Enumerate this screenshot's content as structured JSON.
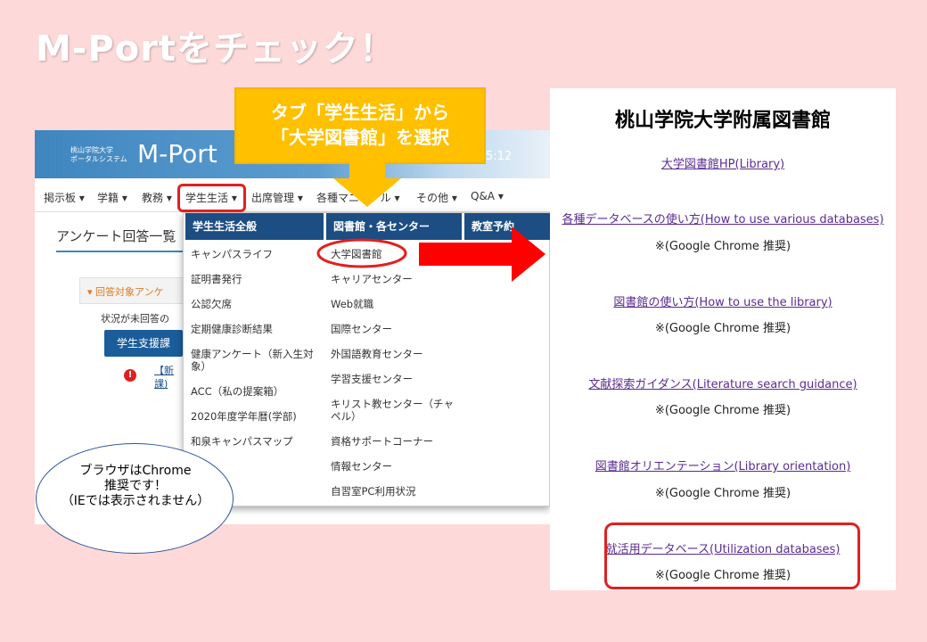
{
  "slide": {
    "title": "M-Portをチェック！"
  },
  "portal": {
    "logo_small_line1": "桃山学院大学",
    "logo_small_line2": "ポータルシステム",
    "logo_big": "M-Port",
    "clock": "5:12",
    "menu": [
      "掲示板 ▾",
      "学籍 ▾",
      "教務 ▾",
      "学生生活 ▾",
      "出席管理 ▾",
      "各種マニュアル ▾",
      "その他 ▾",
      "Q&A ▾"
    ],
    "page_heading": "アンケート回答一覧",
    "survey_label": "▾ 回答対象アンケ",
    "status_text": "状況が未回答の",
    "support_button": "学生支援課",
    "alert_icon": "!",
    "alert_line1": "【新",
    "alert_line2": "課)"
  },
  "dropdown": {
    "col1_header": "学生生活全般",
    "col1_items": [
      "キャンパスライフ",
      "証明書発行",
      "公認欠席",
      "定期健康診断結果",
      "健康アンケート（新入生対象）",
      "ACC（私の提案箱）",
      "2020年度学年暦(学部)",
      "和泉キャンパスマップ"
    ],
    "col2_header": "図書館・各センター",
    "col2_items": [
      "大学図書館",
      "キャリアセンター",
      "Web就職",
      "国際センター",
      "外国語教育センター",
      "学習支援センター",
      "キリスト教センター（チャペル）",
      "資格サポートコーナー",
      "情報センター",
      "自習室PC利用状況"
    ],
    "col3_header": "教室予約"
  },
  "callout": {
    "line1": "タブ「学生生活」から",
    "line2": "「大学図書館」を選択"
  },
  "bubble": {
    "line1": "ブラウザはChrome",
    "line2": "推奨です！",
    "line3": "（IEでは表示されません）"
  },
  "library": {
    "title": "桃山学院大学附属図書館",
    "link_hp": "大学図書館HP(Library)",
    "links": [
      "各種データベースの使い方(How to use various databases)",
      "図書館の使い方(How to use the library)",
      "文献探索ガイダンス(Literature search guidance)",
      "図書館オリエンテーション(Library orientation)",
      "就活用データベース(Utilization databases)"
    ],
    "note": "※(Google Chrome 推奨)"
  },
  "colors": {
    "slide_bg": "#fdd9d9",
    "callout": "#ffc000",
    "highlight_red": "#e02020",
    "dropdown_header": "#1c4d83",
    "link": "#5b2c91"
  }
}
